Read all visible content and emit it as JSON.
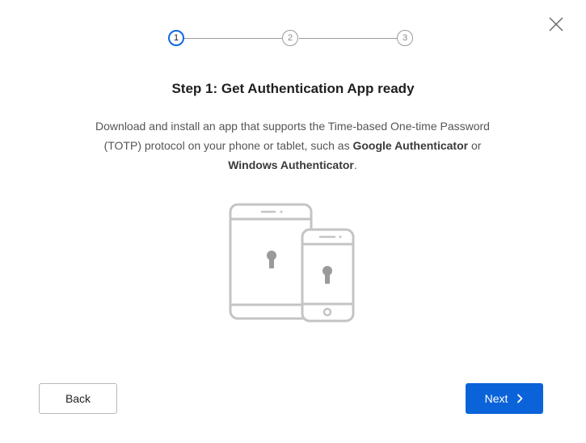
{
  "dialog": {
    "close_icon": "close-icon"
  },
  "stepper": {
    "steps": [
      {
        "label": "1",
        "active": true
      },
      {
        "label": "2",
        "active": false
      },
      {
        "label": "3",
        "active": false
      }
    ],
    "accent_color": "#1068e3"
  },
  "content": {
    "title": "Step 1: Get Authentication App ready",
    "desc_part1": "Download and install an app that supports the Time-based One-time Password (TOTP) protocol on your phone or tablet, such as ",
    "desc_bold1": "Google Authenticator",
    "desc_part2": " or ",
    "desc_bold2": "Windows Authenticator",
    "desc_part3": ".",
    "illustration": "tablet-and-phone-with-lock-icon"
  },
  "footer": {
    "back_label": "Back",
    "next_label": "Next",
    "next_icon": "chevron-right-icon",
    "primary_color": "#0a63d8"
  }
}
